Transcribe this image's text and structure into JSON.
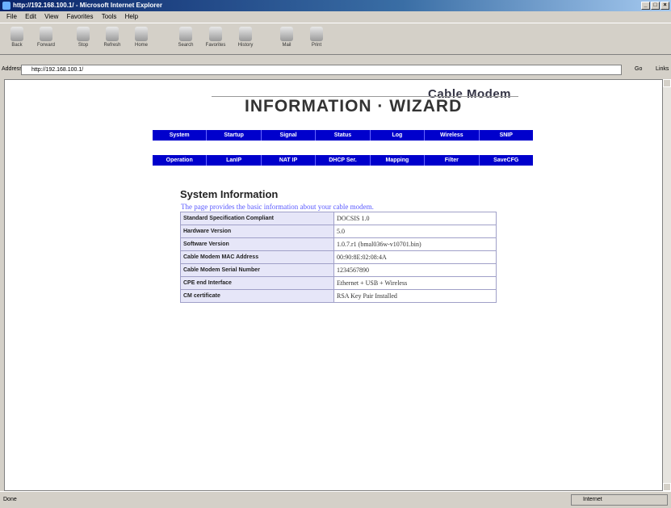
{
  "window": {
    "title": "http://192.168.100.1/ - Microsoft Internet Explorer"
  },
  "menu": [
    "File",
    "Edit",
    "View",
    "Favorites",
    "Tools",
    "Help"
  ],
  "toolbar": {
    "buttons": [
      "Back",
      "Forward",
      "Stop",
      "Refresh",
      "Home",
      "Search",
      "Favorites",
      "History",
      "Mail",
      "Print"
    ]
  },
  "address": {
    "label": "Address",
    "url": "http://192.168.100.1/",
    "go": "Go",
    "links": "Links"
  },
  "status": {
    "left": "Done",
    "zone": "Internet"
  },
  "page": {
    "brand_small": "Cable Modem",
    "brand_big": "INFORMATION  ·  WIZARD",
    "nav1": [
      "System",
      "Startup",
      "Signal",
      "Status",
      "Log",
      "Wireless",
      "SNIP"
    ],
    "nav2": [
      "Operation",
      "LanIP",
      "NAT IP",
      "DHCP Ser.",
      "Mapping",
      "Filter",
      "SaveCFG"
    ],
    "section_title": "System Information",
    "section_desc": "The page provides the basic information about your cable modem.",
    "table": [
      {
        "key": "Standard Specification Compliant",
        "value": "DOCSIS 1.0"
      },
      {
        "key": "Hardware Version",
        "value": "5.0"
      },
      {
        "key": "Software Version",
        "value": "1.0.7.r1 (bmal036w-v10701.bin)"
      },
      {
        "key": "Cable Modem MAC Address",
        "value": "00:90:8E:02:08:4A"
      },
      {
        "key": "Cable Modem Serial Number",
        "value": "1234567890"
      },
      {
        "key": "CPE end Interface",
        "value": "Ethernet + USB + Wireless"
      },
      {
        "key": "CM certificate",
        "value": "RSA Key Pair Installed"
      }
    ]
  }
}
